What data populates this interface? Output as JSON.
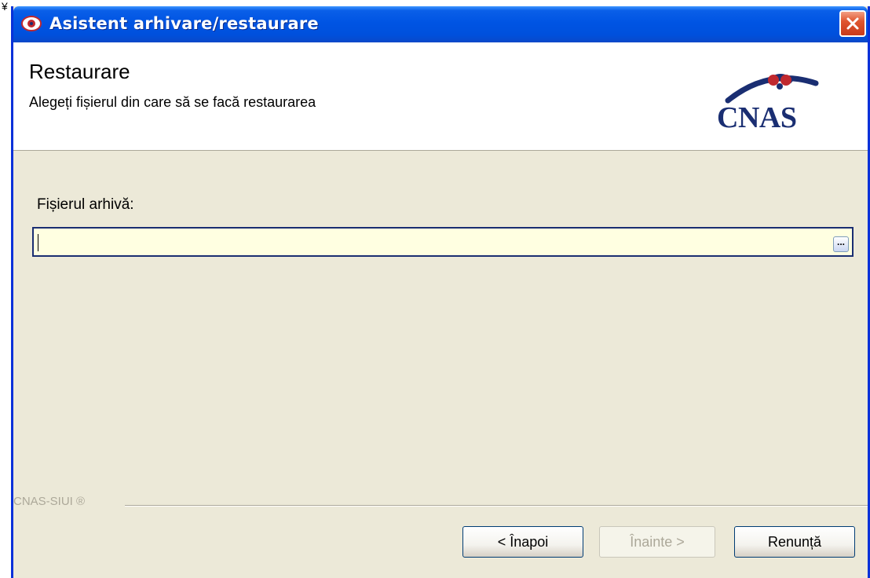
{
  "window": {
    "title": "Asistent arhivare/restaurare",
    "close_icon": "close-icon"
  },
  "header": {
    "title": "Restaurare",
    "subtitle": "Alegeți fișierul din care să se facă restaurarea",
    "logo_text": "CNAS"
  },
  "form": {
    "file_label": "Fișierul arhivă:",
    "file_value": "",
    "browse_label": "..."
  },
  "footer": {
    "brand": "CNAS-SIUI ®"
  },
  "buttons": {
    "back": "< Înapoi",
    "next": "Înainte >",
    "cancel": "Renunță"
  },
  "colors": {
    "titlebar": "#0054e3",
    "window_border": "#0831d9",
    "dialog_bg": "#ece9d8",
    "input_bg": "#ffffe1",
    "logo": "#1a2e72"
  }
}
